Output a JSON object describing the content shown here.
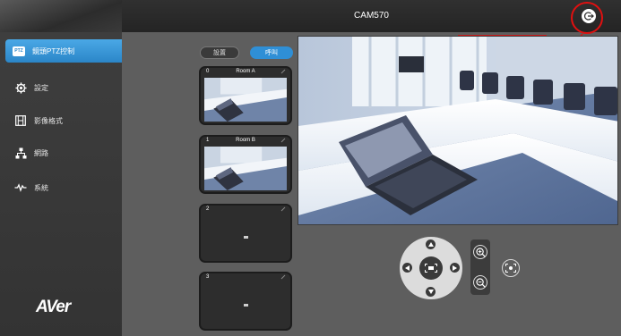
{
  "app": {
    "title": "CAM570",
    "logo_text": "AVer"
  },
  "sidebar": {
    "items": [
      {
        "label": "鏡頭PTZ控制",
        "icon": "ptz-icon",
        "badge": "PTZ",
        "active": true
      },
      {
        "label": "設定",
        "icon": "gear-icon",
        "active": false
      },
      {
        "label": "影像格式",
        "icon": "film-icon",
        "active": false
      },
      {
        "label": "網路",
        "icon": "network-icon",
        "active": false
      },
      {
        "label": "系統",
        "icon": "pulse-icon",
        "active": false
      }
    ]
  },
  "header": {
    "logout_icon": "logout-icon",
    "annotation_label": "登出",
    "annotation_color": "#d01818"
  },
  "presets": {
    "tabs": [
      {
        "label": "設置",
        "active": false
      },
      {
        "label": "呼叫",
        "active": true
      }
    ],
    "items": [
      {
        "number": "0",
        "name": "Room A",
        "has_image": true
      },
      {
        "number": "1",
        "name": "Room B",
        "has_image": true
      },
      {
        "number": "2",
        "name": "",
        "has_image": false
      },
      {
        "number": "3",
        "name": "",
        "has_image": false
      }
    ]
  },
  "controls": {
    "pan_tilt_icons": [
      "arrow-up-icon",
      "arrow-down-icon",
      "arrow-left-icon",
      "arrow-right-icon",
      "home-center-icon"
    ],
    "zoom_in_label": "+",
    "zoom_out_label": "−",
    "fit_icon": "fit-view-icon"
  },
  "colors": {
    "accent": "#2f8fd6",
    "sidebar_bg": "#3a3a3a",
    "content_bg": "#5e5e5e",
    "highlight": "#e01010"
  }
}
